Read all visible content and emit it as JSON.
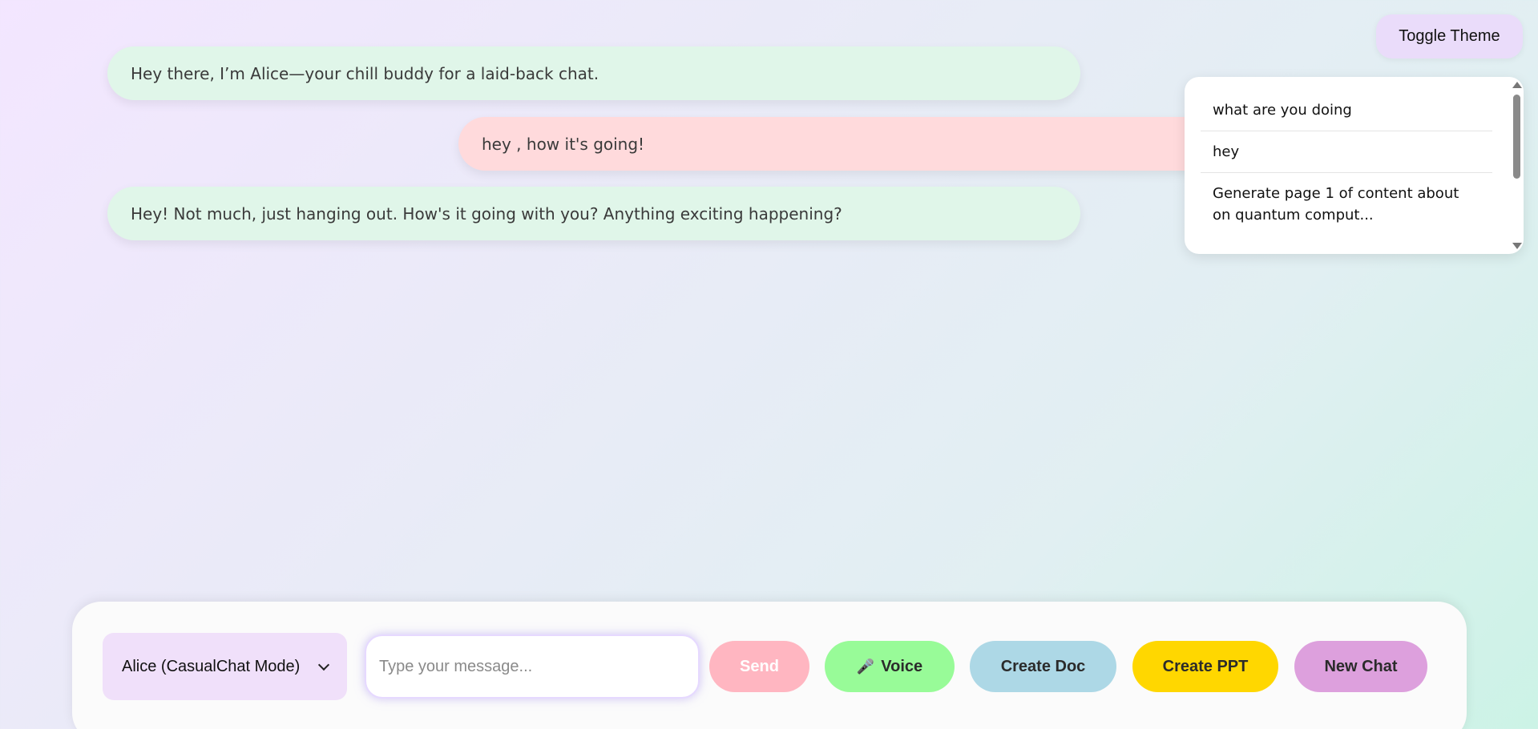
{
  "messages": [
    {
      "role": "bot",
      "text": "Hey there, I’m Alice—your chill buddy for a laid-back chat."
    },
    {
      "role": "user",
      "text": "hey , how it's going!"
    },
    {
      "role": "bot",
      "text": "Hey! Not much, just hanging out. How's it going with you? Anything exciting happening?"
    }
  ],
  "header": {
    "toggle_theme_label": "Toggle Theme"
  },
  "history": {
    "items": [
      {
        "label": "what are you doing"
      },
      {
        "label": "hey"
      },
      {
        "label": "Generate page 1 of content about on quantum comput..."
      }
    ]
  },
  "composer": {
    "mode_selected": "Alice (CasualChat Mode)",
    "input_value": "",
    "input_placeholder": "Type your message...",
    "send_label": "Send",
    "voice_icon": "microphone-icon",
    "voice_label": "Voice",
    "create_doc_label": "Create Doc",
    "create_ppt_label": "Create PPT",
    "new_chat_label": "New Chat"
  },
  "colors": {
    "bot_bubble": "#e0f6e9",
    "user_bubble": "#ffdadc",
    "send_button": "#ffb6c1",
    "voice_button": "#98fb98",
    "create_doc_button": "#add8e6",
    "create_ppt_button": "#ffd700",
    "new_chat_button": "#dda0dd",
    "mode_select": "#f0e0fa",
    "toggle_theme": "#eadcfa"
  }
}
